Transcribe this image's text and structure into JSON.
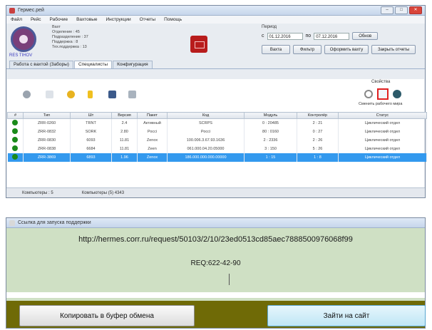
{
  "window1": {
    "title": "Гермес.рей",
    "menu": [
      "Файл",
      "Рейс",
      "Рабочие",
      "Вахтовые",
      "Инструкции",
      "Отчеты",
      "Помощь"
    ],
    "info": {
      "title": "Вахт",
      "lines": [
        "Отделение : 45",
        "Подразделение : 37",
        "Поддержка : 8",
        "Тех.поддержка : 13"
      ]
    },
    "logo_caption": "RES TIHOV",
    "period": {
      "label": "Период",
      "from": "01.12.2016",
      "to": "07.12.2016"
    },
    "buttons": {
      "apply": "Обнов",
      "close": "Вахта",
      "filter": "Фильтр",
      "issue": "Оформить вахту",
      "report": "Закрыть отчеты"
    },
    "tabs": [
      "Работа с вахтой (Заборы)",
      "Специалисты",
      "Конфигурация"
    ],
    "properties": {
      "label": "Свойства",
      "caption": "Сменить рабочего мира"
    },
    "table": {
      "columns": [
        "#",
        "Тип",
        "Шт",
        "Версия",
        "Пакет",
        "Код",
        "Модуль",
        "Контролёр",
        "Статус"
      ],
      "rows": [
        [
          "",
          "ZRR-0260",
          "TRNT",
          "2.4",
          "Активный",
          "SCRPS",
          "0 : 20485",
          "2 : 21",
          "Циклический отдел"
        ],
        [
          "",
          "ZRR-0832",
          "SORK",
          "2.80",
          "Россі",
          "Россі",
          "80 : 0160",
          "0 : 27",
          "Циклический отдел"
        ],
        [
          "",
          "ZRR-0830",
          "6093",
          "11.81",
          "Zenox",
          "100.006.3.67.93.1636",
          "2 : 2336",
          "2 : 26",
          "Циклический отдел"
        ],
        [
          "",
          "ZRR-0838",
          "6684",
          "11.81",
          "Zeen",
          "061.000.04.20.05000",
          "3 : 150",
          "5 : 26",
          "Циклический отдел"
        ],
        [
          "",
          "ZRR-3869",
          "6893",
          "1.96",
          "Zenox",
          "186.000.000.000.00000",
          "1 : 15",
          "1 : 8",
          "Циклический отдел"
        ]
      ]
    },
    "status": {
      "left": "Компьютеры : 5",
      "right": "Компьютеры (5) 4343"
    }
  },
  "window2": {
    "title": "Ссылка для запуска поддержки",
    "url": "http://hermes.corr.ru/request/50103/2/10/23ed0513cd85aec7888500976068f99",
    "req": "REQ:622-42-90",
    "copy_button": "Копировать в буфер обмена",
    "site_button": "Зайти на сайт"
  }
}
